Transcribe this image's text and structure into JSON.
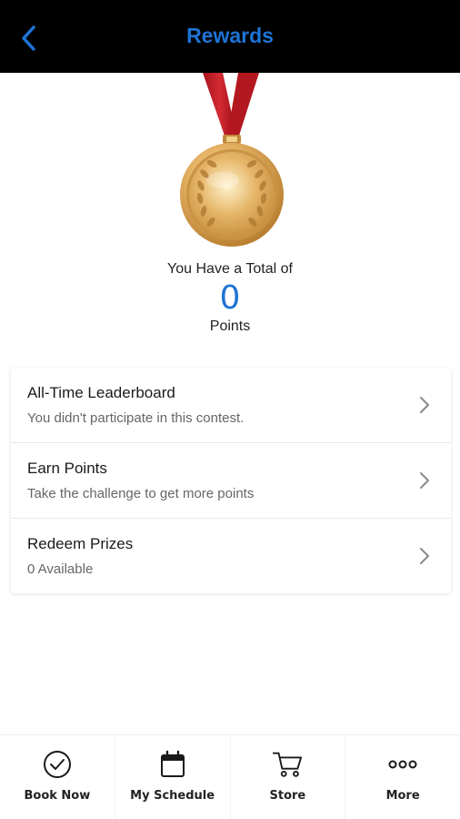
{
  "header": {
    "title": "Rewards",
    "back_icon": "chevron-left-icon",
    "accent_color": "#1e74d6",
    "background_color": "#000000"
  },
  "summary": {
    "total_label": "You Have a Total of",
    "points_value": "0",
    "points_label": "Points",
    "medal_icon": "gold-medal-icon"
  },
  "menu": {
    "items": [
      {
        "title": "All-Time Leaderboard",
        "subtitle": "You didn't participate in this contest.",
        "icon": "chevron-right-icon"
      },
      {
        "title": "Earn Points",
        "subtitle": "Take the challenge to get more points",
        "icon": "chevron-right-icon"
      },
      {
        "title": "Redeem Prizes",
        "subtitle": "0 Available",
        "icon": "chevron-right-icon"
      }
    ]
  },
  "tabbar": {
    "items": [
      {
        "label": "Book Now",
        "icon": "check-circle-icon"
      },
      {
        "label": "My Schedule",
        "icon": "calendar-icon"
      },
      {
        "label": "Store",
        "icon": "shopping-cart-icon"
      },
      {
        "label": "More",
        "icon": "more-dots-icon"
      }
    ]
  }
}
